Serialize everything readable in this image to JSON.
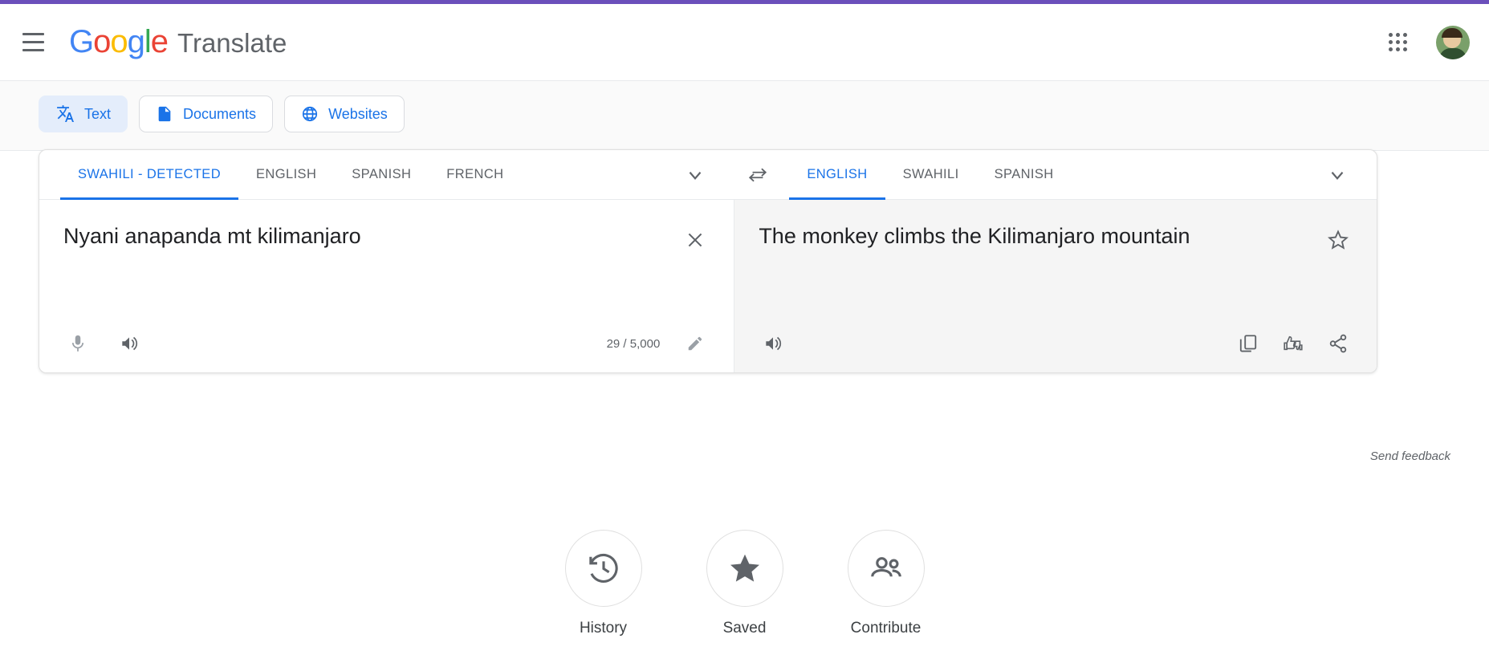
{
  "header": {
    "menu_icon": "hamburger-menu-icon",
    "logo_google": "Google",
    "logo_letters": [
      "G",
      "o",
      "o",
      "g",
      "l",
      "e"
    ],
    "product_name": "Translate",
    "apps_icon": "google-apps-grid-icon",
    "avatar_icon": "account-avatar"
  },
  "modes": [
    {
      "label": "Text",
      "icon": "translate-icon",
      "active": true
    },
    {
      "label": "Documents",
      "icon": "document-icon",
      "active": false
    },
    {
      "label": "Websites",
      "icon": "globe-icon",
      "active": false
    }
  ],
  "source": {
    "languages": [
      "SWAHILI - DETECTED",
      "ENGLISH",
      "SPANISH",
      "FRENCH"
    ],
    "active_language": "SWAHILI - DETECTED",
    "more_icon": "chevron-down-icon",
    "text": "Nyani anapanda mt kilimanjaro",
    "clear_icon": "close-icon",
    "mic_icon": "microphone-icon",
    "speaker_icon": "speaker-icon",
    "counter": "29 / 5,000",
    "edit_icon": "pencil-edit-icon"
  },
  "swap": {
    "icon": "swap-languages-icon"
  },
  "target": {
    "languages": [
      "ENGLISH",
      "SWAHILI",
      "SPANISH"
    ],
    "active_language": "ENGLISH",
    "more_icon": "chevron-down-icon",
    "text": "The monkey climbs the Kilimanjaro mountain",
    "star_icon": "star-outline-icon",
    "speaker_icon": "speaker-icon",
    "copy_icon": "copy-icon",
    "rate_icon": "thumbs-rate-icon",
    "share_icon": "share-icon"
  },
  "feedback_label": "Send feedback",
  "features": [
    {
      "label": "History",
      "icon": "history-clock-icon"
    },
    {
      "label": "Saved",
      "icon": "star-filled-icon"
    },
    {
      "label": "Contribute",
      "icon": "people-contribute-icon"
    }
  ],
  "colors": {
    "accent_blue": "#1a73e8",
    "top_accent_purple": "#6b4fbb",
    "icon_gray": "#5f6368",
    "target_bg": "#f5f5f5"
  }
}
